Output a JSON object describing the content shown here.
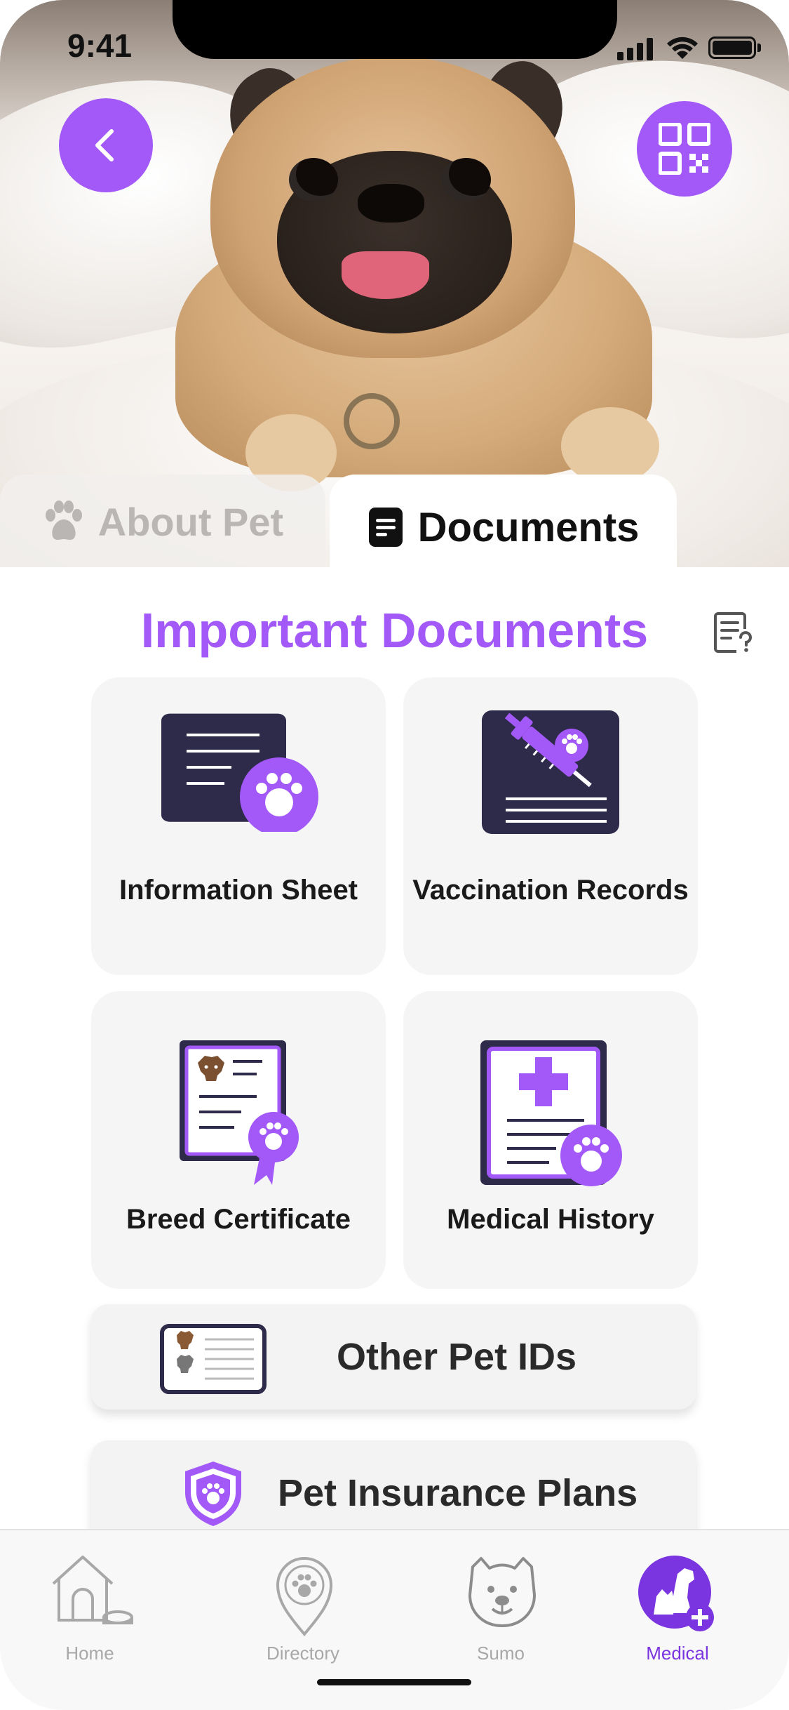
{
  "status_bar": {
    "time": "9:41"
  },
  "tabs": [
    {
      "label": "About Pet",
      "icon": "paw-icon",
      "selected": false
    },
    {
      "label": "Documents",
      "icon": "document-icon",
      "selected": true
    }
  ],
  "section": {
    "title": "Important Documents"
  },
  "documents": [
    {
      "label": "Information Sheet",
      "icon": "information-sheet-icon"
    },
    {
      "label": "Vaccination Records",
      "icon": "vaccination-records-icon"
    },
    {
      "label": "Breed Certificate",
      "icon": "breed-certificate-icon"
    },
    {
      "label": "Medical History",
      "icon": "medical-history-icon"
    }
  ],
  "wide_cards": [
    {
      "label": "Other Pet IDs",
      "icon": "pet-id-card-icon"
    },
    {
      "label": "Pet Insurance Plans",
      "icon": "paw-shield-icon"
    }
  ],
  "bottom_nav": [
    {
      "label": "Home",
      "icon": "doghouse-icon",
      "active": false
    },
    {
      "label": "Directory",
      "icon": "paw-location-pin-icon",
      "active": false
    },
    {
      "label": "Sumo",
      "icon": "dog-face-icon",
      "active": false
    },
    {
      "label": "Medical",
      "icon": "pets-medical-icon",
      "active": true
    }
  ],
  "colors": {
    "accent": "#a259f7",
    "active_nav": "#7a35e0",
    "dark_navy": "#2d2a4a"
  }
}
